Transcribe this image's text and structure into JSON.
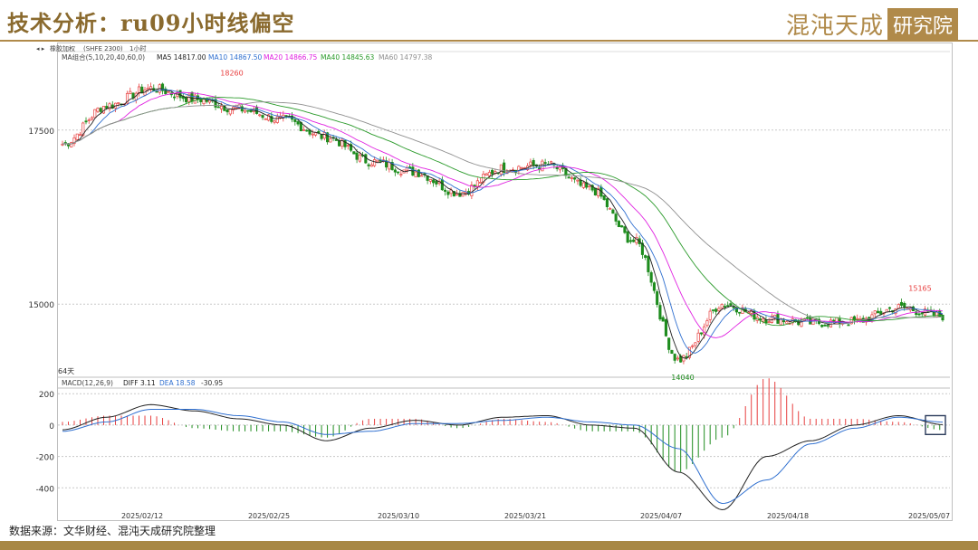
{
  "title": "技术分析：ru09小时线偏空",
  "brand": {
    "name": "混沌天成",
    "box": "研究院"
  },
  "source": "数据来源：文华财经、混沌天成研究院整理",
  "toolbar": {
    "item1": "橡胶加权",
    "item2": "(SHFE 2300)",
    "item3": "1小时"
  },
  "ma_legend": {
    "label": "MA组合(5,10,20,40,60,0)",
    "ma5": "MA5 14817.00",
    "ma10": "MA10 14867.50",
    "ma20": "MA20 14866.75",
    "ma40": "MA40 14845.63",
    "ma60": "MA60 14797.38"
  },
  "macd_legend": {
    "label": "MACD(12,26,9)",
    "diff": "DIFF 3.11",
    "dea": "DEA 18.58",
    "macd": "-30.95"
  },
  "annotations": {
    "high1": "18260",
    "low": "14040",
    "high2": "15165",
    "days": "64天"
  },
  "colors": {
    "up": "#e84040",
    "down": "#1e8c1e",
    "ma5": "#222222",
    "ma10": "#3070d0",
    "ma20": "#e020e0",
    "ma40": "#2a9a2a",
    "ma60": "#909090",
    "diff": "#222222",
    "dea": "#3070d0"
  },
  "chart_data": [
    {
      "type": "line",
      "title": "",
      "ylim": [
        13950,
        18550
      ],
      "yticks": [
        15000,
        17500
      ],
      "x": [
        "2025/02/12",
        "2025/02/25",
        "2025/03/10",
        "2025/03/21",
        "2025/04/07",
        "2025/04/18",
        "2025/05/07"
      ],
      "series": [
        {
          "name": "price",
          "values": [
            17300,
            17850,
            18100,
            17950,
            17800,
            17650,
            17400,
            17050,
            16900,
            16600,
            16950,
            17000,
            16650,
            15900,
            14200,
            15000,
            14800,
            14730,
            14750,
            14950,
            14830
          ]
        }
      ],
      "marked_points": [
        {
          "label": "18260",
          "value": 18260
        },
        {
          "label": "14040",
          "value": 14040
        },
        {
          "label": "15165",
          "value": 15165
        }
      ]
    },
    {
      "type": "bar",
      "title": "MACD(12,26,9)",
      "ylim": [
        -560,
        230
      ],
      "yticks": [
        200,
        0,
        -200,
        -400
      ],
      "series": [
        {
          "name": "DIFF",
          "values": [
            -30,
            50,
            130,
            90,
            40,
            0,
            -100,
            -20,
            30,
            0,
            50,
            60,
            0,
            -20,
            -300,
            -540,
            -200,
            -100,
            0,
            60,
            3
          ]
        },
        {
          "name": "DEA",
          "values": [
            -40,
            20,
            100,
            100,
            60,
            20,
            -60,
            -40,
            10,
            10,
            30,
            50,
            20,
            0,
            -150,
            -500,
            -350,
            -120,
            -20,
            50,
            19
          ]
        }
      ]
    }
  ]
}
